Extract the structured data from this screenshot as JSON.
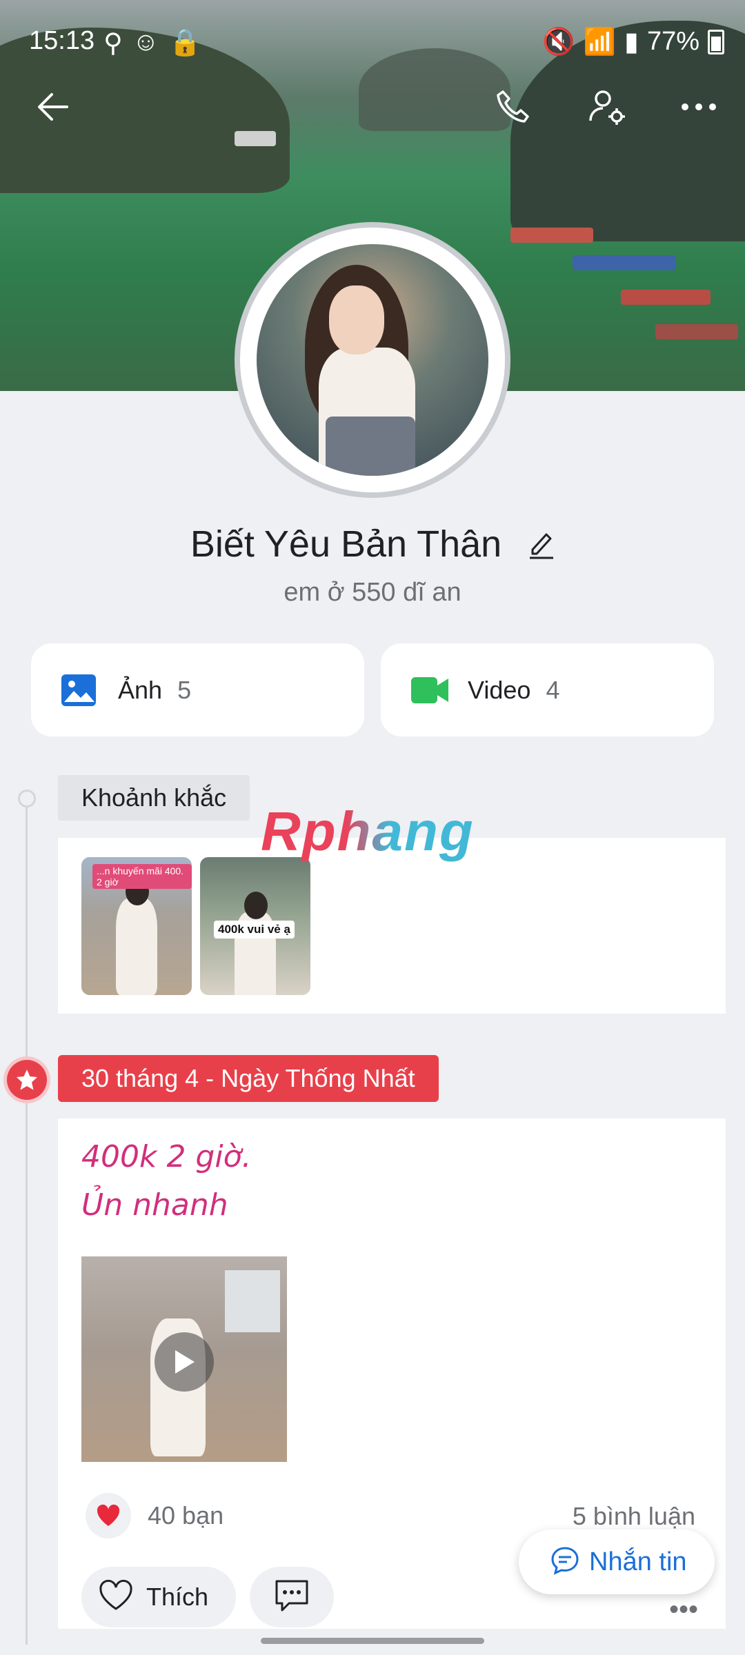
{
  "status": {
    "time": "15:13",
    "battery": "77%"
  },
  "profile": {
    "name": "Biết Yêu Bản Thân",
    "bio": "em ở 550 dĩ an"
  },
  "media": {
    "photos": {
      "label": "Ảnh",
      "count": "5"
    },
    "videos": {
      "label": "Video",
      "count": "4"
    }
  },
  "moments": {
    "label": "Khoảnh khắc",
    "thumbs": [
      {
        "caption": "...n khuyến mãi 400. 2 giờ"
      },
      {
        "caption": "400k vui vẻ ạ"
      }
    ]
  },
  "watermark": "Rphang",
  "post": {
    "holiday": "30 tháng 4 - Ngày Thống Nhất",
    "line1": "400k 2 giờ.",
    "line2": "Ủn nhanh",
    "likes": "40 bạn",
    "comments": "5 bình luận",
    "like_label": "Thích"
  },
  "fab": {
    "message_label": "Nhắn tin"
  },
  "colors": {
    "accent": "#1a6fd9",
    "holiday": "#e8404a",
    "post_text": "#d12f7c",
    "video_icon": "#2fbf5b"
  },
  "icons": [
    "back-arrow-icon",
    "phone-icon",
    "user-settings-icon",
    "more-icon",
    "edit-icon",
    "image-icon",
    "video-icon",
    "star-icon",
    "heart-icon",
    "comment-icon",
    "message-icon",
    "play-icon"
  ]
}
